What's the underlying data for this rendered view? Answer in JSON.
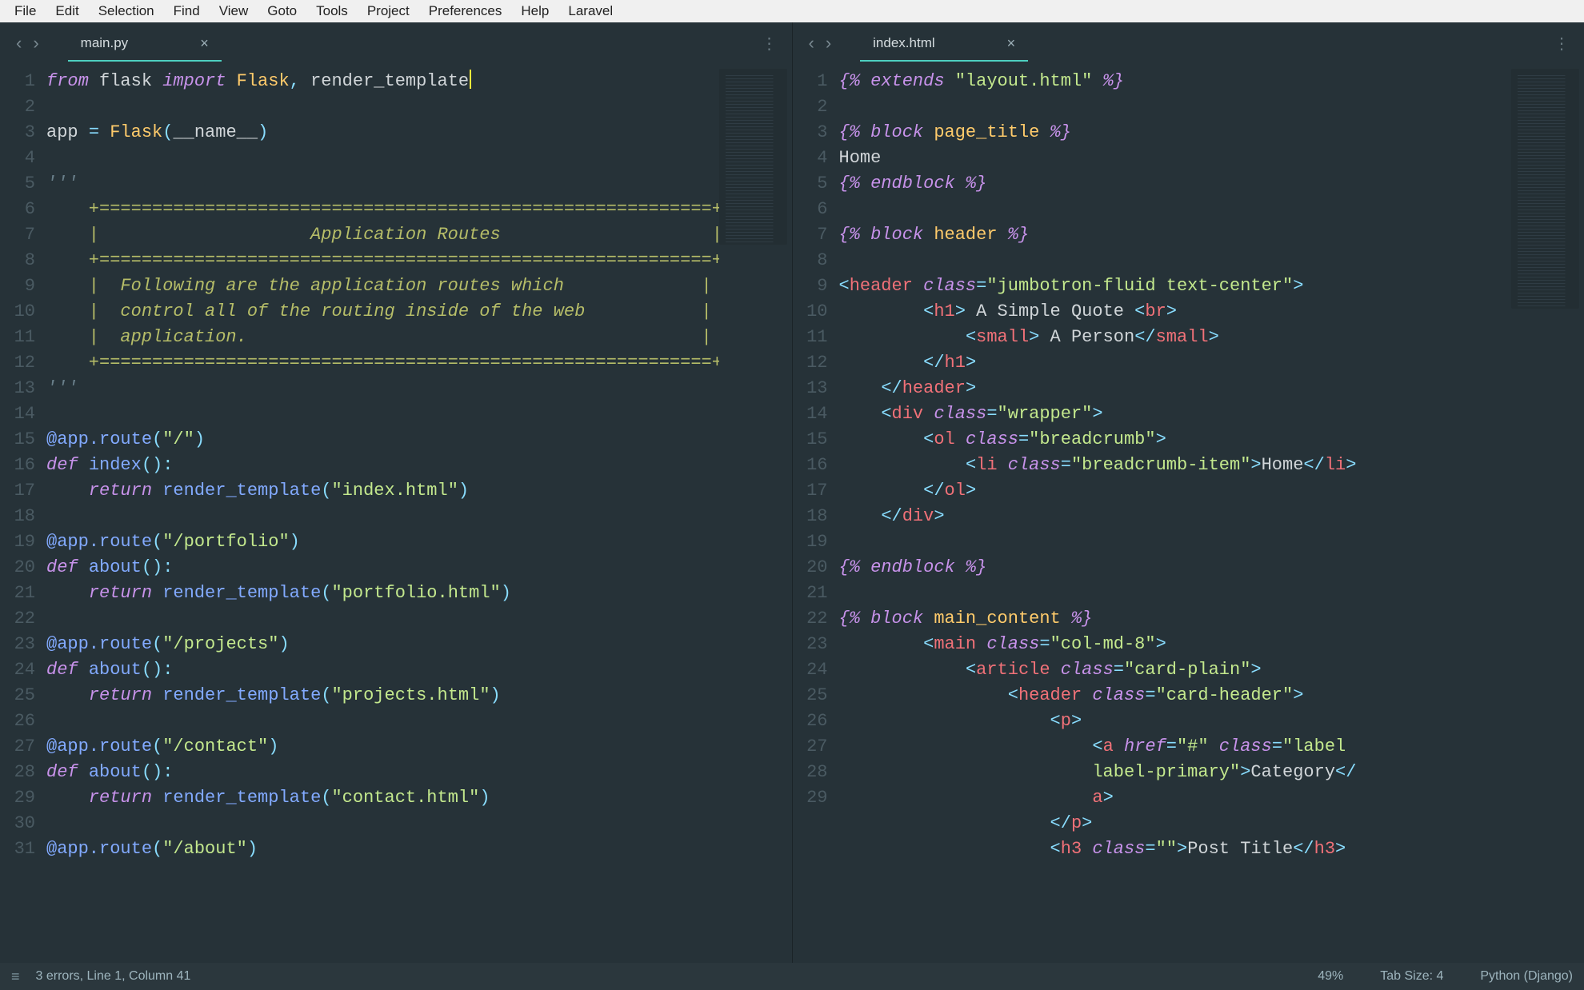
{
  "menu": [
    "File",
    "Edit",
    "Selection",
    "Find",
    "View",
    "Goto",
    "Tools",
    "Project",
    "Preferences",
    "Help",
    "Laravel"
  ],
  "left_pane": {
    "tab": {
      "name": "main.py"
    },
    "lines": 31,
    "error_lines": [
      23,
      27,
      31
    ],
    "code_lines": [
      [
        [
          "kw",
          "from"
        ],
        [
          "txt",
          " flask "
        ],
        [
          "kw",
          "import"
        ],
        [
          "txt",
          " "
        ],
        [
          "cls",
          "Flask"
        ],
        [
          "punct",
          ", "
        ],
        [
          "txt",
          "render_template"
        ],
        [
          "cursor",
          ""
        ]
      ],
      [],
      [
        [
          "txt",
          "app "
        ],
        [
          "op",
          "="
        ],
        [
          "txt",
          " "
        ],
        [
          "cls",
          "Flask"
        ],
        [
          "punct",
          "("
        ],
        [
          "txt",
          "__name__"
        ],
        [
          "punct",
          ")"
        ]
      ],
      [],
      [
        [
          "cmt",
          "'''"
        ]
      ],
      [
        [
          "cmty",
          "    +==========================================================+"
        ]
      ],
      [
        [
          "cmty",
          "    |                    Application Routes                    |"
        ]
      ],
      [
        [
          "cmty",
          "    +==========================================================+"
        ]
      ],
      [
        [
          "cmty",
          "    |  Following are the application routes which             |"
        ]
      ],
      [
        [
          "cmty",
          "    |  control all of the routing inside of the web           |"
        ]
      ],
      [
        [
          "cmty",
          "    |  application.                                           |"
        ]
      ],
      [
        [
          "cmty",
          "    +==========================================================+"
        ]
      ],
      [
        [
          "cmt",
          "'''"
        ]
      ],
      [],
      [
        [
          "fn",
          "@app.route"
        ],
        [
          "punct",
          "("
        ],
        [
          "str",
          "\"/\""
        ],
        [
          "punct",
          ")"
        ]
      ],
      [
        [
          "kw2",
          "def"
        ],
        [
          "txt",
          " "
        ],
        [
          "fn",
          "index"
        ],
        [
          "punct",
          "():"
        ]
      ],
      [
        [
          "txt",
          "    "
        ],
        [
          "kw2",
          "return"
        ],
        [
          "txt",
          " "
        ],
        [
          "fn",
          "render_template"
        ],
        [
          "punct",
          "("
        ],
        [
          "str",
          "\"index.html\""
        ],
        [
          "punct",
          ")"
        ]
      ],
      [],
      [
        [
          "fn",
          "@app.route"
        ],
        [
          "punct",
          "("
        ],
        [
          "str",
          "\"/portfolio\""
        ],
        [
          "punct",
          ")"
        ]
      ],
      [
        [
          "kw2",
          "def"
        ],
        [
          "txt",
          " "
        ],
        [
          "fn",
          "about"
        ],
        [
          "punct",
          "():"
        ]
      ],
      [
        [
          "txt",
          "    "
        ],
        [
          "kw2",
          "return"
        ],
        [
          "txt",
          " "
        ],
        [
          "fn",
          "render_template"
        ],
        [
          "punct",
          "("
        ],
        [
          "str",
          "\"portfolio.html\""
        ],
        [
          "punct",
          ")"
        ]
      ],
      [],
      [
        [
          "fn",
          "@app.route"
        ],
        [
          "punct",
          "("
        ],
        [
          "str",
          "\"/projects\""
        ],
        [
          "punct",
          ")"
        ]
      ],
      [
        [
          "kw2",
          "def"
        ],
        [
          "txt",
          " "
        ],
        [
          "fn",
          "about"
        ],
        [
          "punct",
          "():"
        ]
      ],
      [
        [
          "txt",
          "    "
        ],
        [
          "kw2",
          "return"
        ],
        [
          "txt",
          " "
        ],
        [
          "fn",
          "render_template"
        ],
        [
          "punct",
          "("
        ],
        [
          "str",
          "\"projects.html\""
        ],
        [
          "punct",
          ")"
        ]
      ],
      [],
      [
        [
          "fn",
          "@app.route"
        ],
        [
          "punct",
          "("
        ],
        [
          "str",
          "\"/contact\""
        ],
        [
          "punct",
          ")"
        ]
      ],
      [
        [
          "kw2",
          "def"
        ],
        [
          "txt",
          " "
        ],
        [
          "fn",
          "about"
        ],
        [
          "punct",
          "():"
        ]
      ],
      [
        [
          "txt",
          "    "
        ],
        [
          "kw2",
          "return"
        ],
        [
          "txt",
          " "
        ],
        [
          "fn",
          "render_template"
        ],
        [
          "punct",
          "("
        ],
        [
          "str",
          "\"contact.html\""
        ],
        [
          "punct",
          ")"
        ]
      ],
      [],
      [
        [
          "fn",
          "@app.route"
        ],
        [
          "punct",
          "("
        ],
        [
          "str",
          "\"/about\""
        ],
        [
          "punct",
          ")"
        ]
      ]
    ]
  },
  "right_pane": {
    "tab": {
      "name": "index.html"
    },
    "lines": 29,
    "code_lines": [
      [
        [
          "djt",
          "{% "
        ],
        [
          "djkw",
          "extends"
        ],
        [
          "djt",
          " "
        ],
        [
          "str",
          "\"layout.html\""
        ],
        [
          "djt",
          " %}"
        ]
      ],
      [],
      [
        [
          "djt",
          "{% "
        ],
        [
          "djkw",
          "block"
        ],
        [
          "djt",
          " "
        ],
        [
          "djv",
          "page_title"
        ],
        [
          "djt",
          " %}"
        ]
      ],
      [
        [
          "txt",
          "Home"
        ]
      ],
      [
        [
          "djt",
          "{% "
        ],
        [
          "djkw",
          "endblock"
        ],
        [
          "djt",
          " %}"
        ]
      ],
      [],
      [
        [
          "djt",
          "{% "
        ],
        [
          "djkw",
          "block"
        ],
        [
          "djt",
          " "
        ],
        [
          "djv",
          "header"
        ],
        [
          "djt",
          " %}"
        ]
      ],
      [],
      [
        [
          "ang",
          "<"
        ],
        [
          "tag",
          "header"
        ],
        [
          "txt",
          " "
        ],
        [
          "attr",
          "class"
        ],
        [
          "op",
          "="
        ],
        [
          "str",
          "\"jumbotron-fluid text-center\""
        ],
        [
          "ang",
          ">"
        ]
      ],
      [
        [
          "txt",
          "        "
        ],
        [
          "ang",
          "<"
        ],
        [
          "tag",
          "h1"
        ],
        [
          "ang",
          ">"
        ],
        [
          "txt",
          " A Simple Quote "
        ],
        [
          "ang",
          "<"
        ],
        [
          "tag",
          "br"
        ],
        [
          "ang",
          ">"
        ]
      ],
      [
        [
          "txt",
          "            "
        ],
        [
          "ang",
          "<"
        ],
        [
          "tag",
          "small"
        ],
        [
          "ang",
          ">"
        ],
        [
          "txt",
          " A Person"
        ],
        [
          "ang",
          "</"
        ],
        [
          "tag",
          "small"
        ],
        [
          "ang",
          ">"
        ]
      ],
      [
        [
          "txt",
          "        "
        ],
        [
          "ang",
          "</"
        ],
        [
          "tag",
          "h1"
        ],
        [
          "ang",
          ">"
        ]
      ],
      [
        [
          "txt",
          "    "
        ],
        [
          "ang",
          "</"
        ],
        [
          "tag",
          "header"
        ],
        [
          "ang",
          ">"
        ]
      ],
      [
        [
          "txt",
          "    "
        ],
        [
          "ang",
          "<"
        ],
        [
          "tag",
          "div"
        ],
        [
          "txt",
          " "
        ],
        [
          "attr",
          "class"
        ],
        [
          "op",
          "="
        ],
        [
          "str",
          "\"wrapper\""
        ],
        [
          "ang",
          ">"
        ]
      ],
      [
        [
          "txt",
          "        "
        ],
        [
          "ang",
          "<"
        ],
        [
          "tag",
          "ol"
        ],
        [
          "txt",
          " "
        ],
        [
          "attr",
          "class"
        ],
        [
          "op",
          "="
        ],
        [
          "str",
          "\"breadcrumb\""
        ],
        [
          "ang",
          ">"
        ]
      ],
      [
        [
          "txt",
          "            "
        ],
        [
          "ang",
          "<"
        ],
        [
          "tag",
          "li"
        ],
        [
          "txt",
          " "
        ],
        [
          "attr",
          "class"
        ],
        [
          "op",
          "="
        ],
        [
          "str",
          "\"breadcrumb-item\""
        ],
        [
          "ang",
          ">"
        ],
        [
          "txt",
          "Home"
        ],
        [
          "ang",
          "</"
        ],
        [
          "tag",
          "li"
        ],
        [
          "ang",
          ">"
        ]
      ],
      [
        [
          "txt",
          "        "
        ],
        [
          "ang",
          "</"
        ],
        [
          "tag",
          "ol"
        ],
        [
          "ang",
          ">"
        ]
      ],
      [
        [
          "txt",
          "    "
        ],
        [
          "ang",
          "</"
        ],
        [
          "tag",
          "div"
        ],
        [
          "ang",
          ">"
        ]
      ],
      [],
      [
        [
          "djt",
          "{% "
        ],
        [
          "djkw",
          "endblock"
        ],
        [
          "djt",
          " %}"
        ]
      ],
      [],
      [
        [
          "djt",
          "{% "
        ],
        [
          "djkw",
          "block"
        ],
        [
          "djt",
          " "
        ],
        [
          "djv",
          "main_content"
        ],
        [
          "djt",
          " %}"
        ]
      ],
      [
        [
          "txt",
          "        "
        ],
        [
          "ang",
          "<"
        ],
        [
          "tag",
          "main"
        ],
        [
          "txt",
          " "
        ],
        [
          "attr",
          "class"
        ],
        [
          "op",
          "="
        ],
        [
          "str",
          "\"col-md-8\""
        ],
        [
          "ang",
          ">"
        ]
      ],
      [
        [
          "txt",
          "            "
        ],
        [
          "ang",
          "<"
        ],
        [
          "tag",
          "article"
        ],
        [
          "txt",
          " "
        ],
        [
          "attr",
          "class"
        ],
        [
          "op",
          "="
        ],
        [
          "str",
          "\"card-plain\""
        ],
        [
          "ang",
          ">"
        ]
      ],
      [
        [
          "txt",
          "                "
        ],
        [
          "ang",
          "<"
        ],
        [
          "tag",
          "header"
        ],
        [
          "txt",
          " "
        ],
        [
          "attr",
          "class"
        ],
        [
          "op",
          "="
        ],
        [
          "str",
          "\"card-header\""
        ],
        [
          "ang",
          ">"
        ]
      ],
      [
        [
          "txt",
          "                    "
        ],
        [
          "ang",
          "<"
        ],
        [
          "tag",
          "p"
        ],
        [
          "ang",
          ">"
        ]
      ],
      [
        [
          "txt",
          "                        "
        ],
        [
          "ang",
          "<"
        ],
        [
          "tag",
          "a"
        ],
        [
          "txt",
          " "
        ],
        [
          "attr",
          "href"
        ],
        [
          "op",
          "="
        ],
        [
          "str",
          "\"#\""
        ],
        [
          "txt",
          " "
        ],
        [
          "attr",
          "class"
        ],
        [
          "op",
          "="
        ],
        [
          "str",
          "\"label "
        ],
        [
          "txt",
          "\n                        "
        ],
        [
          "str",
          "label-primary\""
        ],
        [
          "ang",
          ">"
        ],
        [
          "txt",
          "Category"
        ],
        [
          "ang",
          "</"
        ],
        [
          "txt",
          "\n                        "
        ],
        [
          "tag",
          "a"
        ],
        [
          "ang",
          ">"
        ]
      ],
      [
        [
          "txt",
          "                    "
        ],
        [
          "ang",
          "</"
        ],
        [
          "tag",
          "p"
        ],
        [
          "ang",
          ">"
        ]
      ],
      [
        [
          "txt",
          "                    "
        ],
        [
          "ang",
          "<"
        ],
        [
          "tag",
          "h3"
        ],
        [
          "txt",
          " "
        ],
        [
          "attr",
          "class"
        ],
        [
          "op",
          "="
        ],
        [
          "str",
          "\"\""
        ],
        [
          "ang",
          ">"
        ],
        [
          "txt",
          "Post Title"
        ],
        [
          "ang",
          "</"
        ],
        [
          "tag",
          "h3"
        ],
        [
          "ang",
          ">"
        ]
      ]
    ]
  },
  "status": {
    "left": "3 errors, Line 1, Column 41",
    "zoom": "49%",
    "tab_size": "Tab Size: 4",
    "syntax": "Python (Django)"
  }
}
